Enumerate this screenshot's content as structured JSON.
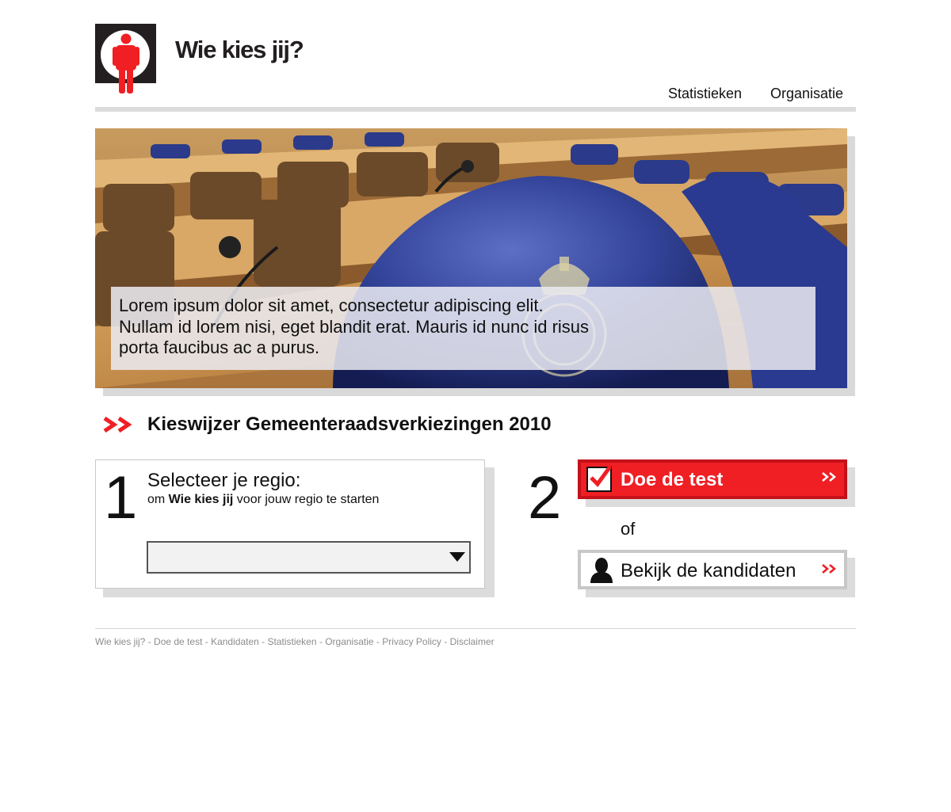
{
  "site": {
    "title": "Wie kies jij?",
    "brand_color": "#ef1f24"
  },
  "header": {
    "nav": [
      {
        "label": "Statistieken"
      },
      {
        "label": "Organisatie"
      }
    ]
  },
  "hero": {
    "image_description_icon": "parliament-seats-photo",
    "caption": "Lorem ipsum dolor sit amet, consectetur adipiscing elit. Nullam id lorem nisi, eget blandit erat. Mauris id nunc id risus porta faucibus ac a purus."
  },
  "main": {
    "heading": "Kieswijzer Gemeenteraadsverkiezingen 2010",
    "step1": {
      "number": "1",
      "title": "Selecteer je regio:",
      "subtitle_prefix": "om ",
      "subtitle_bold": "Wie kies jij",
      "subtitle_suffix": " voor jouw regio te starten",
      "select_value": ""
    },
    "step2": {
      "number": "2",
      "test_button": "Doe de test",
      "or": "of",
      "candidates_button": "Bekijk de kandidaten"
    }
  },
  "footer": {
    "links": [
      "Wie kies jij?",
      "Doe de test",
      "Kandidaten",
      "Statistieken",
      "Organisatie",
      "Privacy Policy",
      "Disclaimer"
    ]
  }
}
